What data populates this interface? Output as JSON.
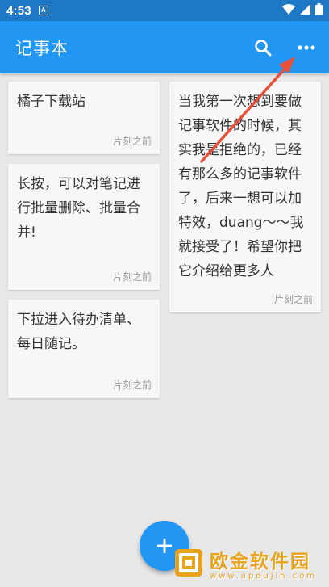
{
  "status_bar": {
    "time": "4:53",
    "notification_letter": "A"
  },
  "app_bar": {
    "title": "记事本",
    "search_icon": "search-icon",
    "more_icon": "more-horizontal-icon"
  },
  "notes": [
    {
      "text": "橘子下载站",
      "time": "片刻之前"
    },
    {
      "text": "长按，可以对笔记进行批量删除、批量合并!",
      "time": "片刻之前"
    },
    {
      "text": "下拉进入待办清单、每日随记。",
      "time": "片刻之前"
    },
    {
      "text": "当我第一次想到要做记事软件的时候，其实我是拒绝的，已经有那么多的记事软件了，后来一想可以加特效，duang～～我就接受了！希望你把它介绍给更多人",
      "time": "片刻之前"
    }
  ],
  "fab": {
    "icon": "plus-icon"
  },
  "watermark": {
    "title": "欧金软件园",
    "url": "www.apoujin.com"
  },
  "colors": {
    "status_bar": "#1f78c5",
    "app_bar": "#2196f3",
    "background": "#e8e8e8",
    "card": "#f7f7f7",
    "annotation": "#e8503a"
  }
}
